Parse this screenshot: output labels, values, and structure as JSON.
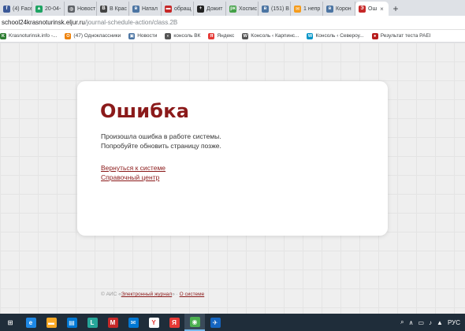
{
  "browser": {
    "tabs": [
      {
        "label": "(4) Face",
        "icon": "facebook-icon",
        "color": "#3b5998",
        "glyph": "f"
      },
      {
        "label": "20-04-",
        "icon": "google-drive-icon",
        "color": "#1fa463",
        "glyph": "▲"
      },
      {
        "label": "Новост",
        "icon": "globe-icon",
        "color": "#5f6368",
        "glyph": "◍"
      },
      {
        "label": "В Крас",
        "icon": "b-site-icon",
        "color": "#444444",
        "glyph": "B"
      },
      {
        "label": "Натал",
        "icon": "vk-icon",
        "color": "#4c75a3",
        "glyph": "в"
      },
      {
        "label": "обращ",
        "icon": "flag-icon",
        "color": "#c62828",
        "glyph": "▬"
      },
      {
        "label": "Дожит",
        "icon": "plus-icon",
        "color": "#222222",
        "glyph": "+"
      },
      {
        "label": "Хоспис",
        "icon": "pk-icon",
        "color": "#43a047",
        "glyph": "рк"
      },
      {
        "label": "(151) В",
        "icon": "vk-icon",
        "color": "#4c75a3",
        "glyph": "в"
      },
      {
        "label": "1 непр",
        "icon": "mail-icon",
        "color": "#f59b1b",
        "glyph": "✉"
      },
      {
        "label": "Корон",
        "icon": "vk-icon",
        "color": "#4c75a3",
        "glyph": "в"
      },
      {
        "label": "Ош",
        "icon": "eljur-icon",
        "color": "#c62828",
        "glyph": "Э",
        "active": true
      }
    ],
    "new_tab": "+",
    "close_glyph": "×",
    "address": {
      "host": "school24krasnoturinsk.eljur.ru",
      "path": "/journal-schedule-action/class.2B"
    },
    "bookmarks": [
      {
        "label": "Krasnoturinsk.info -...",
        "icon": "krasnoturinsk-icon",
        "color": "#2e7d32",
        "glyph": "K"
      },
      {
        "label": "(47) Одноклассники",
        "icon": "odnoklassniki-icon",
        "color": "#ee8208",
        "glyph": "О"
      },
      {
        "label": "Новости",
        "icon": "news-icon",
        "color": "#4c75a3",
        "glyph": "▣"
      },
      {
        "label": "консоль ВК",
        "icon": "console-icon",
        "color": "#555555",
        "glyph": "◐"
      },
      {
        "label": "Яндекс",
        "icon": "yandex-icon",
        "color": "#e53935",
        "glyph": "Я"
      },
      {
        "label": "Консоль ‹ Карпинс...",
        "icon": "wordpress-icon",
        "color": "#555555",
        "glyph": "W"
      },
      {
        "label": "Консоль ‹ Североу...",
        "icon": "wordpress-icon",
        "color": "#0095c8",
        "glyph": "W"
      },
      {
        "label": "Результат теста PAEI",
        "icon": "paei-icon",
        "color": "#b71c1c",
        "glyph": "●"
      }
    ]
  },
  "page": {
    "title": "Ошибка",
    "message_line1": "Произошла ошибка в работе системы.",
    "message_line2": "Попробуйте обновить страницу позже.",
    "link_back": "Вернуться к системе",
    "link_help": "Справочный центр",
    "footer_prefix": "© АИС «",
    "footer_link": "Электронный журнал",
    "footer_sep": "» · ",
    "footer_about": "О системе"
  },
  "taskbar": {
    "apps": [
      {
        "icon": "windows-start-icon",
        "color": "#1f2d3a",
        "glyph": "⊞"
      },
      {
        "icon": "edge-icon",
        "color": "#1e88e5",
        "glyph": "e"
      },
      {
        "icon": "file-explorer-icon",
        "color": "#f9a825",
        "glyph": "▬"
      },
      {
        "icon": "store-icon",
        "color": "#0078d4",
        "glyph": "▤"
      },
      {
        "icon": "launcher-icon",
        "color": "#26a69a",
        "glyph": "L"
      },
      {
        "icon": "mcafee-icon",
        "color": "#c62828",
        "glyph": "M"
      },
      {
        "icon": "mail-icon",
        "color": "#0078d4",
        "glyph": "✉"
      },
      {
        "icon": "yandex-browser-icon",
        "color": "#ffffff",
        "glyph": "Y"
      },
      {
        "icon": "yandex-icon",
        "color": "#e53935",
        "glyph": "Я"
      },
      {
        "icon": "chrome-icon",
        "color": "#4caf50",
        "glyph": "◉",
        "active": true
      },
      {
        "icon": "messenger-icon",
        "color": "#1565c0",
        "glyph": "✈"
      }
    ],
    "tray": [
      "⌕",
      "∧",
      "▭",
      "♪",
      "▲",
      "РУС"
    ]
  },
  "colors": {
    "accent": "#8b1a1a",
    "taskbar": "#1f2d3a"
  }
}
